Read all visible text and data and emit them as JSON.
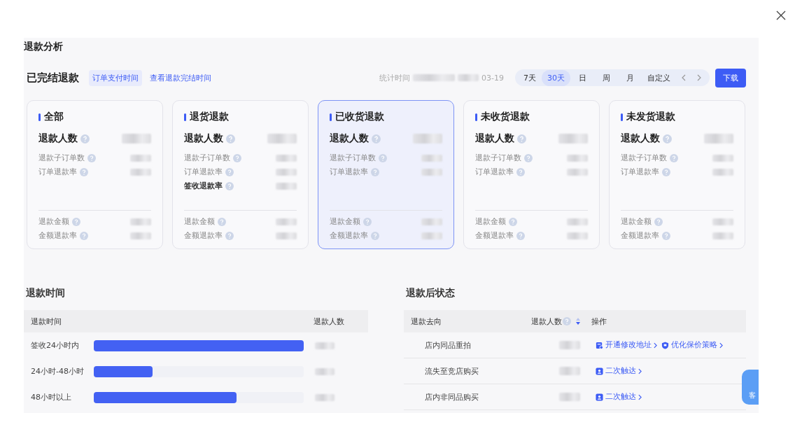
{
  "page_title": "退款分析",
  "header": {
    "title": "已完结退款",
    "tabs": [
      {
        "label": "订单支付时间",
        "selected": true
      },
      {
        "label": "查看退款完结时间",
        "selected": false
      }
    ],
    "stat_label": "统计时间",
    "stat_date": "03-19",
    "ranges": [
      {
        "label": "7天",
        "selected": false
      },
      {
        "label": "30天",
        "selected": true
      },
      {
        "label": "日",
        "selected": false
      },
      {
        "label": "周",
        "selected": false
      },
      {
        "label": "月",
        "selected": false
      },
      {
        "label": "自定义",
        "selected": false
      }
    ],
    "download": "下载"
  },
  "cards": [
    {
      "title": "全部",
      "selected": false,
      "groups": [
        [
          {
            "label": "退款人数",
            "kind": "headline"
          },
          {
            "label": "退款子订单数",
            "kind": "normal"
          },
          {
            "label": "订单退款率",
            "kind": "normal"
          }
        ],
        [
          {
            "label": "退款金额",
            "kind": "normal"
          },
          {
            "label": "金额退款率",
            "kind": "normal"
          }
        ]
      ]
    },
    {
      "title": "退货退款",
      "selected": false,
      "groups": [
        [
          {
            "label": "退款人数",
            "kind": "headline"
          },
          {
            "label": "退款子订单数",
            "kind": "normal"
          },
          {
            "label": "订单退款率",
            "kind": "normal"
          },
          {
            "label": "签收退款率",
            "kind": "strong"
          }
        ],
        [
          {
            "label": "退款金额",
            "kind": "normal"
          },
          {
            "label": "金额退款率",
            "kind": "normal"
          }
        ]
      ]
    },
    {
      "title": "已收货退款",
      "selected": true,
      "groups": [
        [
          {
            "label": "退款人数",
            "kind": "headline"
          },
          {
            "label": "退款子订单数",
            "kind": "normal"
          },
          {
            "label": "订单退款率",
            "kind": "normal"
          }
        ],
        [
          {
            "label": "退款金额",
            "kind": "normal"
          },
          {
            "label": "金额退款率",
            "kind": "normal"
          }
        ]
      ]
    },
    {
      "title": "未收货退款",
      "selected": false,
      "groups": [
        [
          {
            "label": "退款人数",
            "kind": "headline"
          },
          {
            "label": "退款子订单数",
            "kind": "normal"
          },
          {
            "label": "订单退款率",
            "kind": "normal"
          }
        ],
        [
          {
            "label": "退款金额",
            "kind": "normal"
          },
          {
            "label": "金额退款率",
            "kind": "normal"
          }
        ]
      ]
    },
    {
      "title": "未发货退款",
      "selected": false,
      "groups": [
        [
          {
            "label": "退款人数",
            "kind": "headline"
          },
          {
            "label": "退款子订单数",
            "kind": "normal"
          },
          {
            "label": "订单退款率",
            "kind": "normal"
          }
        ],
        [
          {
            "label": "退款金额",
            "kind": "normal"
          },
          {
            "label": "金额退款率",
            "kind": "normal"
          }
        ]
      ]
    }
  ],
  "refund_time": {
    "title": "退款时间",
    "columns": [
      "退款时间",
      "退款人数"
    ],
    "rows": [
      {
        "label": "签收24小时内",
        "level": 1.0
      },
      {
        "label": "24小时-48小时",
        "level": 0.28
      },
      {
        "label": "48小时以上",
        "level": 0.68
      }
    ]
  },
  "after_status": {
    "title": "退款后状态",
    "columns": [
      "退款去向",
      "退款人数",
      "操作"
    ],
    "rows": [
      {
        "destination": "店内同品重拍",
        "actions": [
          {
            "label": "开通修改地址",
            "kind": "address"
          },
          {
            "label": "优化保价策略",
            "kind": "shield"
          }
        ]
      },
      {
        "destination": "流失至竞店购买",
        "actions": [
          {
            "label": "二次触达",
            "kind": "message"
          }
        ]
      },
      {
        "destination": "店内非同品购买",
        "actions": [
          {
            "label": "二次触达",
            "kind": "message"
          }
        ]
      }
    ]
  },
  "service_widget": "客"
}
